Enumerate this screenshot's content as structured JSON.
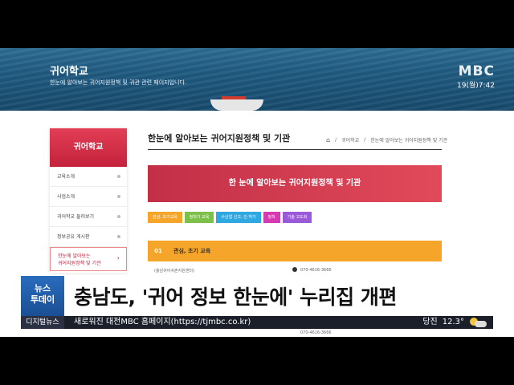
{
  "hero": {
    "title": "귀어학교",
    "subtitle": "한눈에 알아보는 귀어지원정책 및 귀관 관련 페이지입니다.",
    "broadcaster": "MBC",
    "clock": "19(월)7:42"
  },
  "sidebar": {
    "heading": "귀어학교",
    "items": [
      {
        "label": "교육소개"
      },
      {
        "label": "사업소개"
      },
      {
        "label": "귀어학교 둘러보기"
      },
      {
        "label": "정보공유 게시판"
      },
      {
        "label_line1": "한눈에 알아보는",
        "label_line2": "귀어지원정책 및 기관"
      }
    ]
  },
  "main": {
    "title": "한눈에 알아보는 귀어지원정책 및 기관",
    "breadcrumb": [
      "귀어학교",
      "한눈에 알아보는 귀어지원정책 및 기관"
    ],
    "banner": "한 눈에 알아보는 귀어지원정책 및 기관",
    "chips": [
      {
        "label": "관심, 초기교육",
        "color": "#f4a52a"
      },
      {
        "label": "정착기 교육",
        "color": "#7cc04a"
      },
      {
        "label": "수산업 신고, 인·허가",
        "color": "#2fa7e0"
      },
      {
        "label": "정착",
        "color": "#d53bb0"
      },
      {
        "label": "기술 고도화",
        "color": "#9a5ad8"
      }
    ],
    "section": {
      "num": "01",
      "label": "관심, 초기 교육"
    },
    "rows": [
      {
        "org": "(충남귀어귀촌지원센터)",
        "tel": "070-4616-3666"
      },
      {
        "org": "",
        "tel": "070-4616-3666"
      }
    ]
  },
  "caption": {
    "badge_line1": "뉴스",
    "badge_line2": "투데이",
    "headline": "충남도, '귀어 정보 한눈에' 누리집 개편"
  },
  "ticker": {
    "tag": "디지털뉴스",
    "text": "새로워진 대전MBC 홈페이지(https://tjmbc.co.kr)",
    "city": "당진",
    "temp": "12.3°",
    "weather_icon": "partly-cloudy-icon"
  }
}
